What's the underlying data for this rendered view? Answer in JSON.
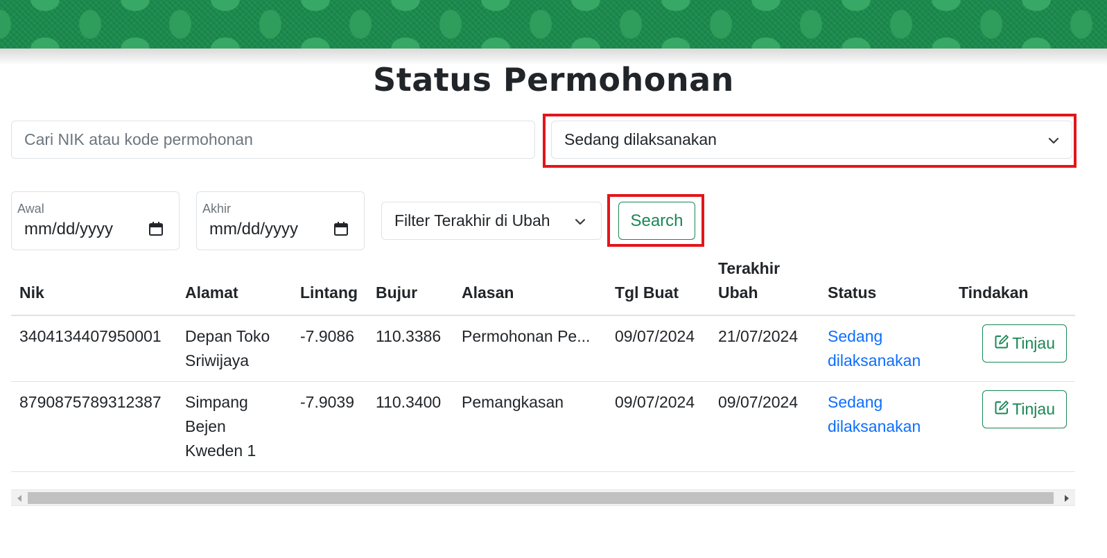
{
  "page": {
    "title": "Status Permohonan"
  },
  "search": {
    "placeholder": "Cari NIK atau kode permohonan",
    "value": ""
  },
  "status_filter": {
    "selected": "Sedang dilaksanakan"
  },
  "date_start": {
    "label": "Awal",
    "value": "mm/dd/yyyy"
  },
  "date_end": {
    "label": "Akhir",
    "value": "mm/dd/yyyy"
  },
  "sort_filter": {
    "selected": "Filter Terakhir di Ubah"
  },
  "search_button": {
    "label": "Search"
  },
  "table": {
    "headers": {
      "nik": "Nik",
      "alamat": "Alamat",
      "lintang": "Lintang",
      "bujur": "Bujur",
      "alasan": "Alasan",
      "tgl_buat": "Tgl Buat",
      "terakhir_ubah_1": "Terakhir",
      "terakhir_ubah_2": "Ubah",
      "status": "Status",
      "tindakan": "Tindakan"
    },
    "rows": [
      {
        "nik": "3404134407950001",
        "alamat_1": "Depan Toko",
        "alamat_2": "Sriwijaya",
        "alamat_3": "",
        "lintang": "-7.9086",
        "bujur": "110.3386",
        "alasan": "Permohonan Pe...",
        "tgl_buat": "09/07/2024",
        "terakhir_ubah": "21/07/2024",
        "status_1": "Sedang",
        "status_2": "dilaksanakan",
        "action": "Tinjau"
      },
      {
        "nik": "8790875789312387",
        "alamat_1": "Simpang",
        "alamat_2": "Bejen",
        "alamat_3": "Kweden 1",
        "lintang": "-7.9039",
        "bujur": "110.3400",
        "alasan": "Pemangkasan",
        "tgl_buat": "09/07/2024",
        "terakhir_ubah": "09/07/2024",
        "status_1": "Sedang",
        "status_2": "dilaksanakan",
        "action": "Tinjau"
      }
    ]
  },
  "icons": {
    "chevron": "chevron-down-icon",
    "calendar": "calendar-icon",
    "edit": "edit-icon",
    "scroll_left": "scroll-left-arrow-icon",
    "scroll_right": "scroll-right-arrow-icon"
  },
  "colors": {
    "banner": "#1a8a4c",
    "primary_green": "#198754",
    "link_blue": "#0d6efd",
    "highlight_red": "#e3151a"
  }
}
